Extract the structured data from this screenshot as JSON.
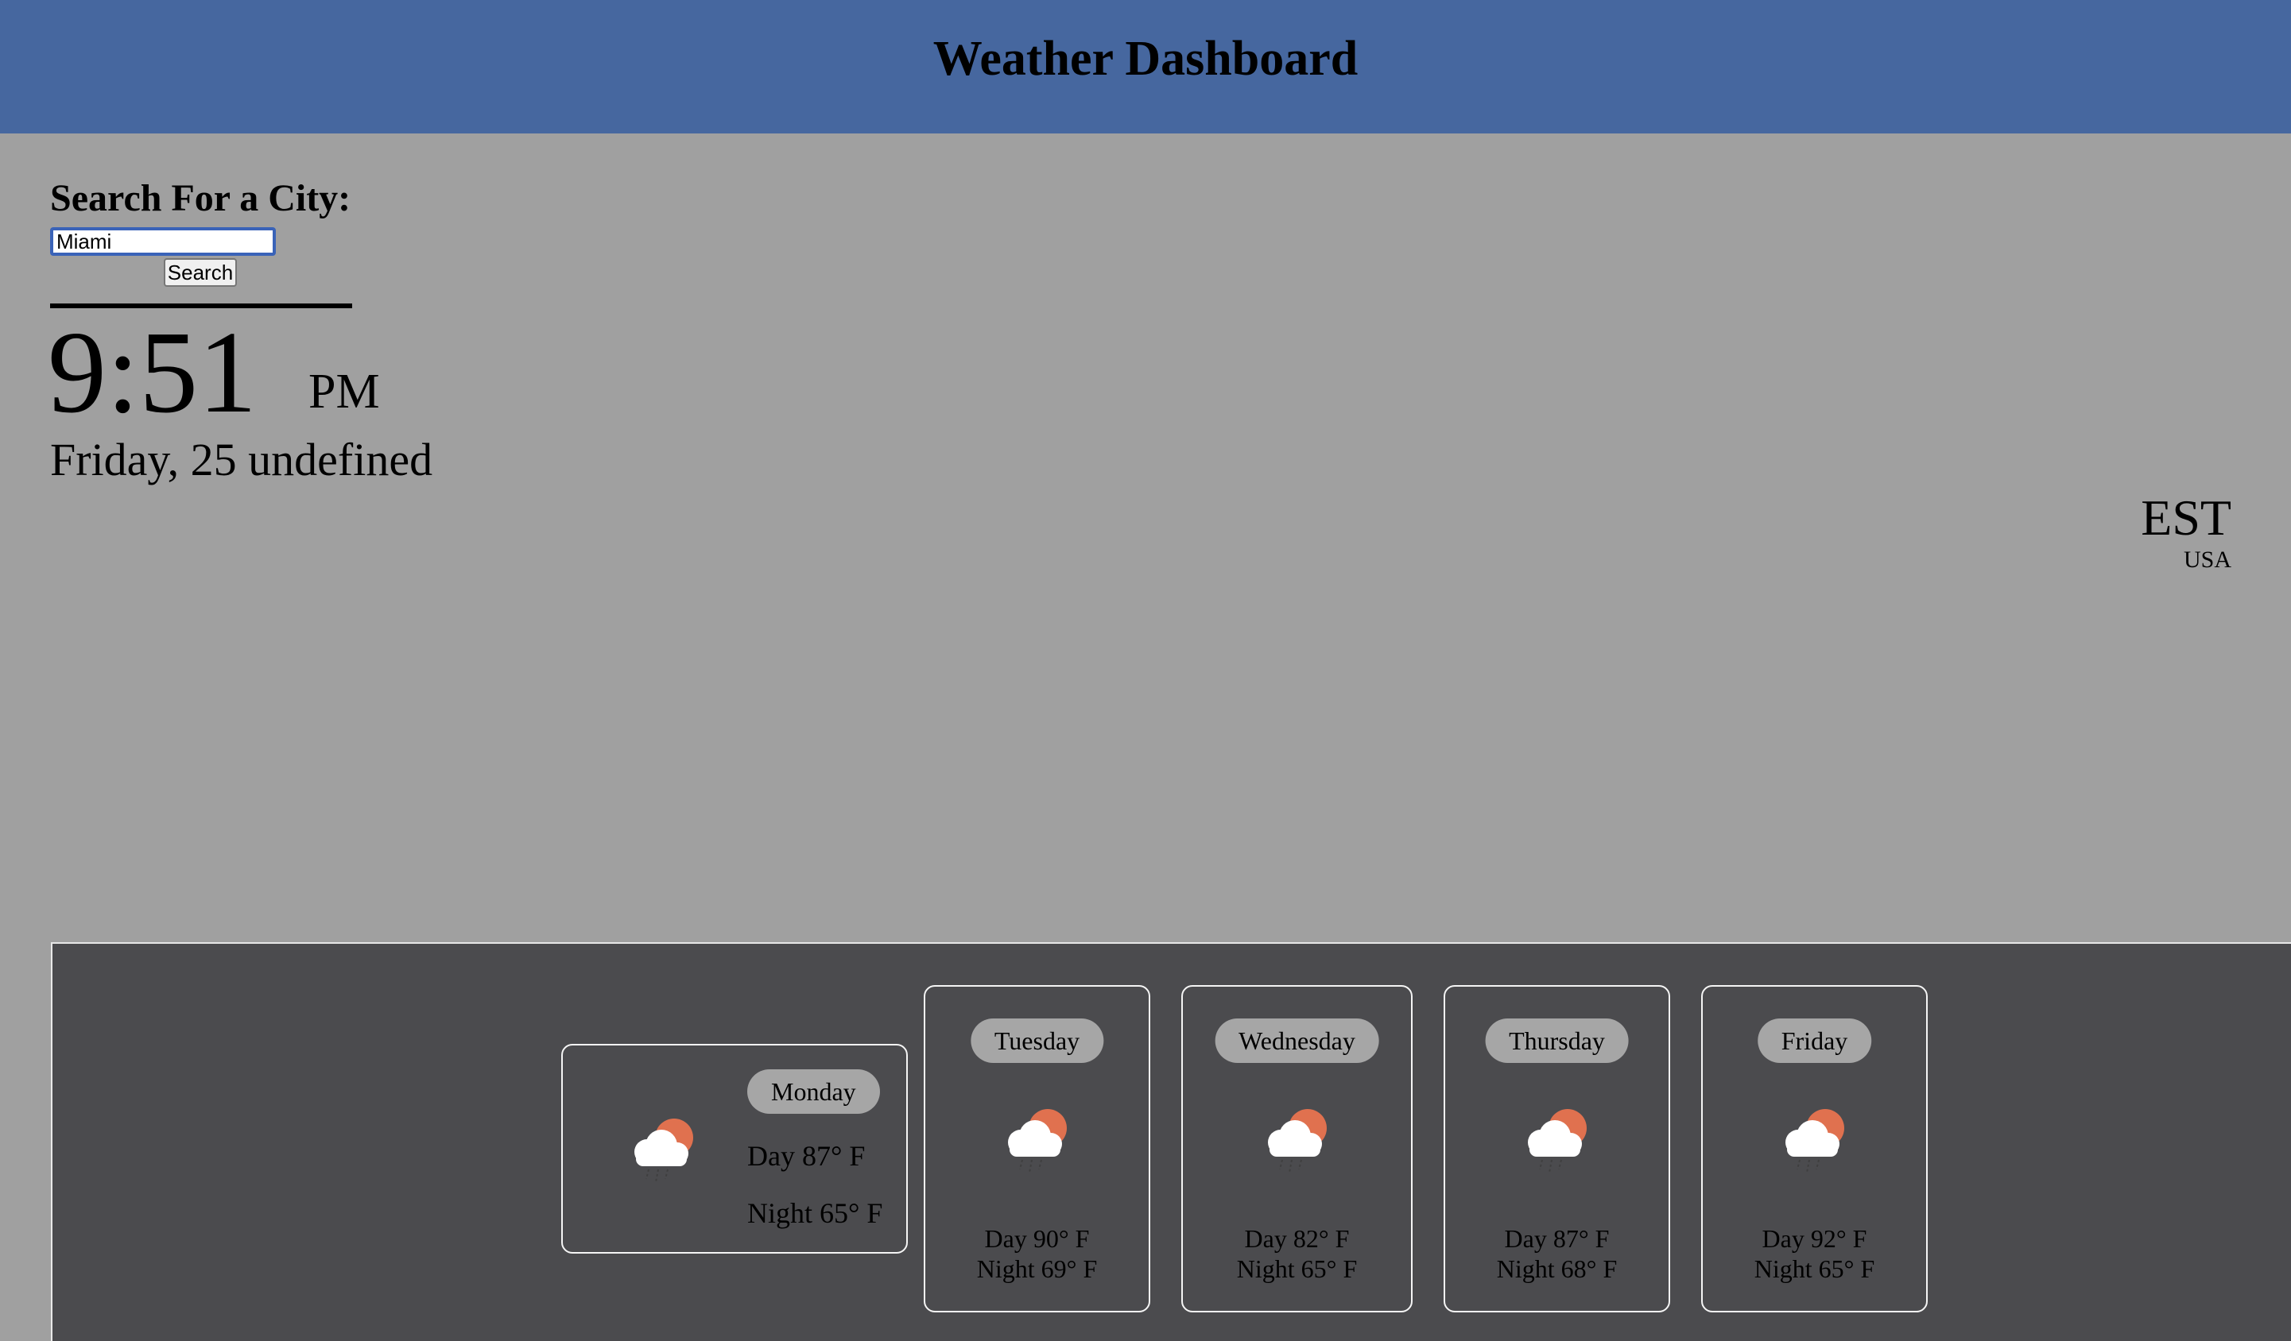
{
  "header": {
    "title": "Weather Dashboard"
  },
  "search": {
    "label": "Search For a City:",
    "value": "Miami",
    "button_label": "Search"
  },
  "clock": {
    "time": "9:51",
    "ampm": "PM",
    "date": "Friday, 25 undefined",
    "timezone": "EST",
    "country": "USA"
  },
  "forecast": {
    "today": {
      "day": "Monday",
      "day_temp": "Day 87° F",
      "night_temp": "Night 65° F",
      "icon": "partly-cloudy-rain-icon"
    },
    "days": [
      {
        "day": "Tuesday",
        "day_temp": "Day 90° F",
        "night_temp": "Night 69° F",
        "icon": "partly-cloudy-rain-icon"
      },
      {
        "day": "Wednesday",
        "day_temp": "Day 82° F",
        "night_temp": "Night 65° F",
        "icon": "partly-cloudy-rain-icon"
      },
      {
        "day": "Thursday",
        "day_temp": "Day 87° F",
        "night_temp": "Night 68° F",
        "icon": "partly-cloudy-rain-icon"
      },
      {
        "day": "Friday",
        "day_temp": "Day 92° F",
        "night_temp": "Night 65° F",
        "icon": "partly-cloudy-rain-icon"
      }
    ]
  },
  "colors": {
    "header_bg": "#46679f",
    "page_bg": "#a0a0a0",
    "forecast_bg": "#4b4b4e",
    "pill_bg": "#a6a6a6",
    "sun": "#e0714f"
  }
}
